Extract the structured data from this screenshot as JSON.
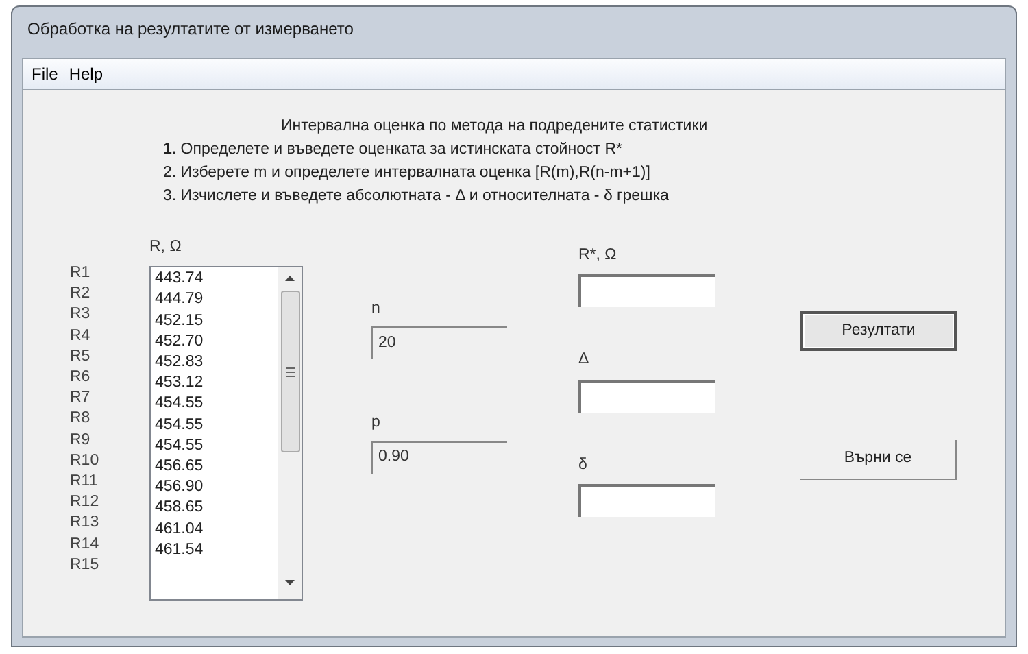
{
  "window": {
    "title": "Обработка на резултатите от измерването"
  },
  "menu": [
    "File",
    "Help"
  ],
  "instructions": {
    "heading": "Интервална оценка по метода на подредените статистики",
    "steps": [
      "**1.** Определете и въведете оценката за истинската стойност R*",
      "2. Изберете m и определете интервалната оценка [R(m),R(n-m+1)]",
      "3. Изчислете и въведете абсолютната - Δ и относителната - δ грешка"
    ]
  },
  "measurements": {
    "label": "R, Ω",
    "row_labels": [
      "R1",
      "R2",
      "R3",
      "R4",
      "R5",
      "R6",
      "R7",
      "R8",
      "R9",
      "R10",
      "R11",
      "R12",
      "R13",
      "R14",
      "R15"
    ],
    "values": [
      "443.74",
      "444.79",
      "452.15",
      "452.70",
      "452.83",
      "453.12",
      "454.55",
      "454.55",
      "454.55",
      "456.65",
      "456.90",
      "458.65",
      "461.04",
      "461.54"
    ]
  },
  "n": {
    "label": "n",
    "value": "20"
  },
  "p": {
    "label": "p",
    "value": "0.90"
  },
  "outputs": [
    {
      "label": "R*, Ω"
    },
    {
      "label": "Δ"
    },
    {
      "label": "δ"
    }
  ],
  "buttons": [
    {
      "label": "Резултати",
      "focused": true
    },
    {
      "label": "Върни се",
      "focused": false
    }
  ]
}
